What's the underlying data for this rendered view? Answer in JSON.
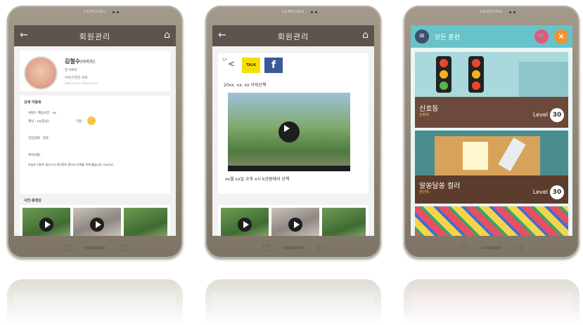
{
  "brand": "SAMSUNG",
  "member": {
    "header_title": "회원관리",
    "profile": {
      "name": "김철수",
      "relation": "(아버지)",
      "age": "만 68세",
      "service_count": "서비스받은 6회",
      "period": "20xx.xx.xx~20xx.xx.xx"
    },
    "detail_heading": "상세 이용표",
    "detail_lines": [
      "서비스 제공시간 : xx",
      "책식 : xx(증상)",
      "기분 :",
      "건강상태 : 양호",
      "특이사항 :",
      "오늘은 기분이 좋으시고 반다면이 좋아서 산책을 하게 했습니다. (xx/xx)"
    ],
    "media_heading": "사진·동영상"
  },
  "post": {
    "header_title": "회원관리",
    "share_label": "공유",
    "kakao_label": "TALK",
    "facebook_label": "f",
    "date_title": "20xx. xx. xx 야외산책",
    "caption": "xx월 xx일 오후 x시 k공원에서 산책"
  },
  "training": {
    "header_title": "모든 훈련",
    "items": [
      {
        "title": "신호등",
        "subtitle": "순발력",
        "level_label": "Level",
        "level": "30",
        "color": "#6b4a3c"
      },
      {
        "title": "알쏭달쏭 컬러",
        "subtitle": "판단력",
        "level_label": "Level",
        "level": "30",
        "color": "#5c3c2c"
      }
    ],
    "accent": "#67c3c9"
  },
  "icons": {
    "back": "arrow-left-icon",
    "home": "home-icon",
    "menu": "menu-icon",
    "cart": "cart-icon",
    "close": "close-icon",
    "share": "share-icon",
    "play": "play-icon",
    "mood": "emoji-icon"
  }
}
